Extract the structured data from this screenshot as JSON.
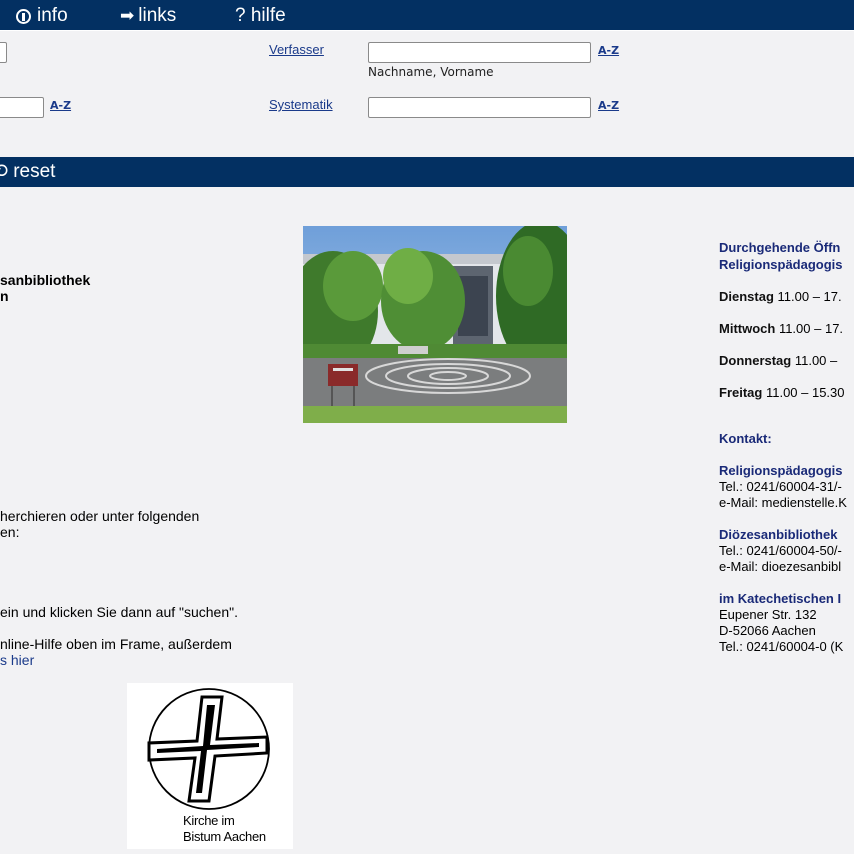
{
  "topbar": {
    "info_label": "info",
    "links_label": "links",
    "hilfe_label": "? hilfe"
  },
  "form": {
    "verfasser_label": "Verfasser",
    "verfasser_value": "",
    "verfasser_hint": "Nachname, Vorname",
    "systematik_label": "Systematik",
    "systematik_value": "",
    "az_label": "A-Z"
  },
  "actions": {
    "reset_label": "reset"
  },
  "left": {
    "name_line1": "sanbibliothek",
    "name_line2": "n",
    "para1_line1": "herchieren oder unter folgenden",
    "para1_line2": "en:",
    "para2": "ein und klicken Sie dann auf \"suchen\".",
    "para3": "nline-Hilfe oben im Frame, außerdem",
    "para3_link": "s hier"
  },
  "logo": {
    "caption_line1": "Kirche im",
    "caption_line2": "Bistum Aachen"
  },
  "right": {
    "heading_line1": "Durchgehende Öffn",
    "heading_line2": "Religionspädagogis",
    "days": [
      {
        "day": "Dienstag",
        "time": " 11.00 – 17."
      },
      {
        "day": "Mittwoch",
        "time": " 11.00 – 17."
      },
      {
        "day": "Donnerstag",
        "time": " 11.00 –"
      },
      {
        "day": "Freitag",
        "time": " 11.00 – 15.30"
      }
    ],
    "kontakt": "Kontakt:",
    "contacts": [
      {
        "name": "Religionspädagogis",
        "tel": "Tel.: 0241/60004-31/-",
        "mail": "e-Mail: medienstelle.K"
      },
      {
        "name": "Diözesanbibliothek ",
        "tel": "Tel.: 0241/60004-50/-",
        "mail": "e-Mail: dioezesanbibl"
      }
    ],
    "address": {
      "name": "im Katechetischen I",
      "street": "Eupener Str. 132",
      "city": "D-52066 Aachen",
      "tel": "Tel.: 0241/60004-0 (K"
    }
  },
  "colors": {
    "nav_bar": "#033062",
    "link": "#1a3a8a",
    "heading": "#1a2a78"
  }
}
